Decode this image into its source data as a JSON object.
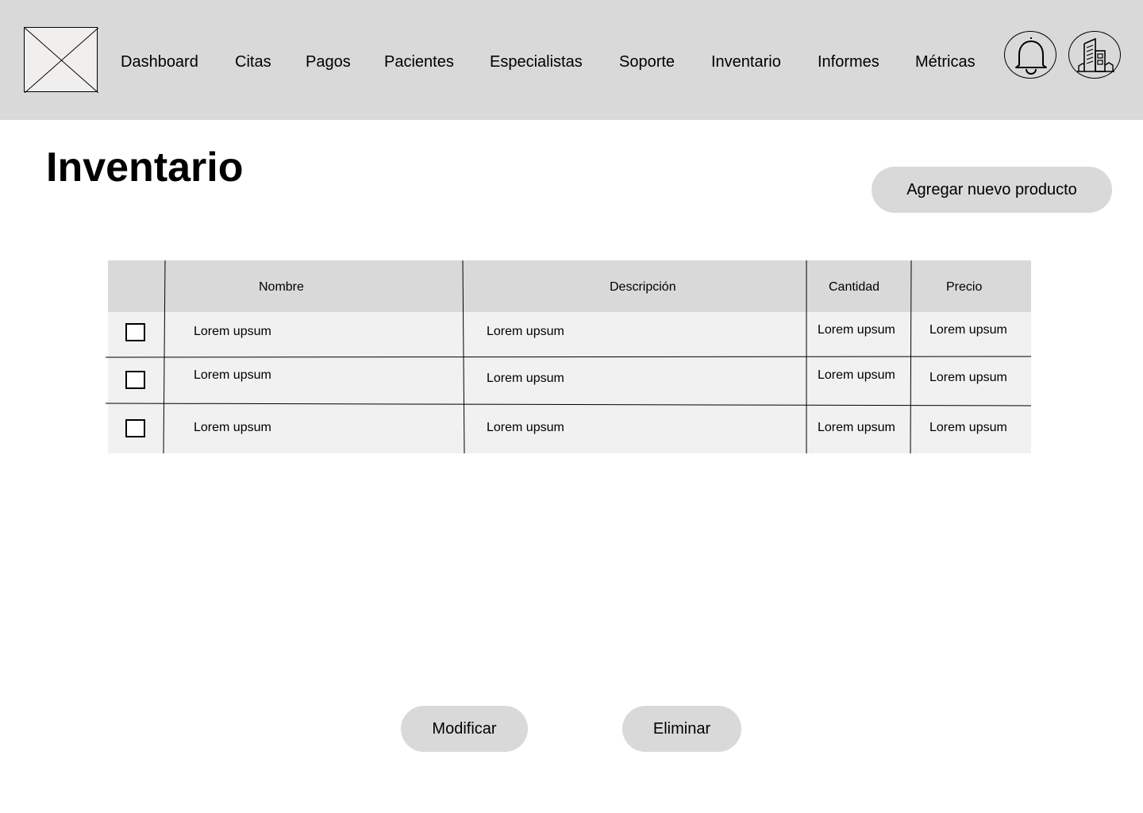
{
  "header": {
    "logo": "image-placeholder",
    "nav": [
      "Dashboard",
      "Citas",
      "Pagos",
      "Pacientes",
      "Especialistas",
      "Soporte",
      "Inventario",
      "Informes",
      "Métricas"
    ],
    "icons": [
      "bell-icon",
      "building-icon"
    ]
  },
  "page": {
    "title": "Inventario",
    "add_button": "Agregar nuevo producto"
  },
  "table": {
    "columns": [
      "Nombre",
      "Descripción",
      "Cantidad",
      "Precio"
    ],
    "rows": [
      {
        "nombre": "Lorem upsum",
        "descripcion": "Lorem upsum",
        "cantidad": "Lorem upsum",
        "precio": "Lorem upsum"
      },
      {
        "nombre": "Lorem upsum",
        "descripcion": "Lorem upsum",
        "cantidad": "Lorem upsum",
        "precio": "Lorem upsum"
      },
      {
        "nombre": "Lorem upsum",
        "descripcion": "Lorem upsum",
        "cantidad": "Lorem upsum",
        "precio": "Lorem upsum"
      }
    ]
  },
  "actions": {
    "modify": "Modificar",
    "delete": "Eliminar"
  },
  "colors": {
    "header_bg": "#d9d9d9",
    "table_body_bg": "#f2f1f1",
    "button_bg": "#d9d9d9",
    "logo_bg": "#f1efee"
  }
}
